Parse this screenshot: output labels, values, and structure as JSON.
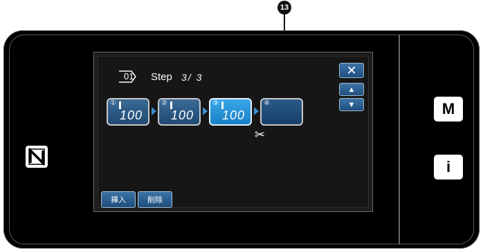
{
  "callout": {
    "label": "13"
  },
  "icons": {
    "nfc": "nfc-icon",
    "pattern_frame": "diamond-icon",
    "needle": "needle-icon",
    "scissors": "scissors-icon",
    "close": "close-icon",
    "up": "triangle-up-icon",
    "down": "triangle-down-icon"
  },
  "screen": {
    "pattern_no": "01",
    "step_label": "Step",
    "step_counter": "3/ 3"
  },
  "steps": [
    {
      "num": "①",
      "value": "100",
      "state": "normal"
    },
    {
      "num": "②",
      "value": "100",
      "state": "normal"
    },
    {
      "num": "③",
      "value": "100",
      "state": "active"
    },
    {
      "num": "④",
      "value": "",
      "state": "empty"
    }
  ],
  "controls": {
    "close": "✕",
    "up": "▲",
    "down": "▼",
    "scissors": "✂",
    "insert": "挿入",
    "delete": "削除"
  },
  "hardware_keys": {
    "menu": "M",
    "info": "i"
  },
  "colors": {
    "panel_bg": "#000000",
    "screen_bg": "#161616",
    "button_blue": "#204a72",
    "button_active": "#1a7fc4",
    "arrow_blue": "#3b8fd0"
  }
}
